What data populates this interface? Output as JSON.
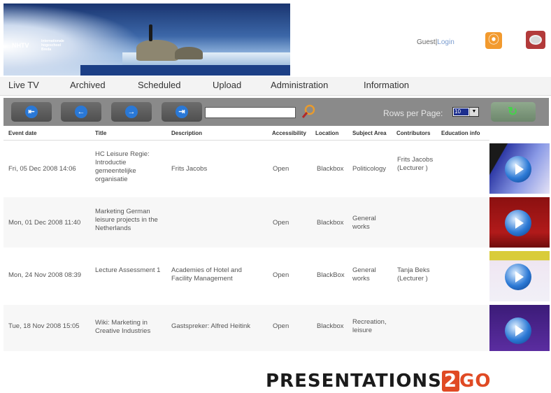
{
  "header": {
    "logo_text": "NHTV",
    "logo_sub": "Internationale hogeschool Breda",
    "guest_label": "Guest",
    "separator": "|",
    "login_label": "Login"
  },
  "nav": [
    {
      "label": "Live TV"
    },
    {
      "label": "Archived"
    },
    {
      "label": "Scheduled"
    },
    {
      "label": "Upload"
    },
    {
      "label": "Administration"
    },
    {
      "label": "Information"
    }
  ],
  "toolbar": {
    "first_icon": "first-page-icon",
    "prev_icon": "previous-page-icon",
    "next_icon": "next-page-icon",
    "last_icon": "last-page-icon",
    "search_value": "",
    "rows_per_page_label": "Rows per Page:",
    "rows_per_page_value": "10"
  },
  "table": {
    "headers": [
      "Event date",
      "Title",
      "Description",
      "Accessibility",
      "Location",
      "Subject Area",
      "Contributors",
      "Education info"
    ],
    "rows": [
      {
        "date": "Fri, 05 Dec 2008 14:06",
        "title": "HC Leisure Regie: Introductie gemeentelijke organisatie",
        "description": "Frits Jacobs",
        "access": "Open",
        "location": "Blackbox",
        "subject": "Politicology",
        "contributors": "Frits Jacobs (Lecturer )",
        "education": ""
      },
      {
        "date": "Mon, 01 Dec 2008 11:40",
        "title": "Marketing German leisure projects in the Netherlands",
        "description": "",
        "access": "Open",
        "location": "Blackbox",
        "subject": "General works",
        "contributors": "",
        "education": ""
      },
      {
        "date": "Mon, 24 Nov 2008 08:39",
        "title": "Lecture Assessment 1",
        "description": "Academies of Hotel and Facility Management",
        "access": "Open",
        "location": "BlackBox",
        "subject": "General works",
        "contributors": "Tanja Beks (Lecturer )",
        "education": ""
      },
      {
        "date": "Tue, 18 Nov 2008 15:05",
        "title": "Wiki: Marketing in Creative Industries",
        "description": "Gastspreker: Alfred Heitink",
        "access": "Open",
        "location": "Blackbox",
        "subject": "Recreation, leisure",
        "contributors": "",
        "education": ""
      }
    ]
  },
  "brand": {
    "word": "PRESENTATIONS",
    "two": "2",
    "go": "GO"
  },
  "colors": {
    "toolbar": "#8a8a8a",
    "button_blue": "#2a78d6",
    "brand_red": "#e04a24"
  }
}
